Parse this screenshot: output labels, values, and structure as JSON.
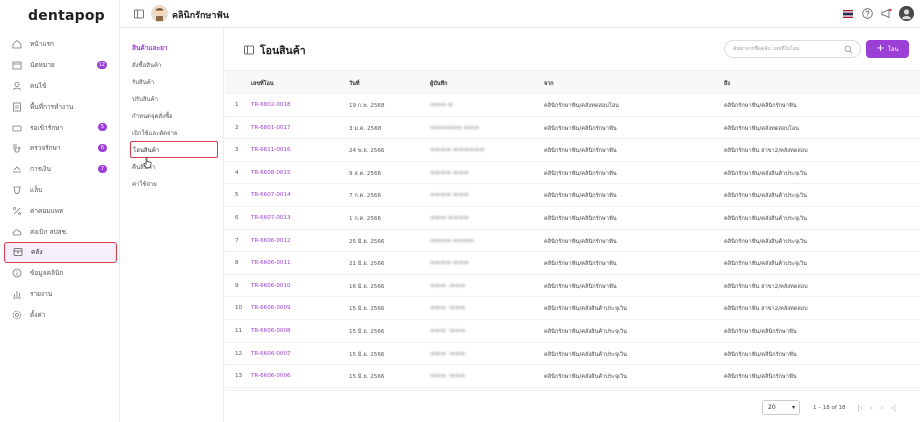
{
  "app": {
    "logo": "dentapop",
    "clinic_name": "คลินิกรักษาฟัน"
  },
  "sidebar": {
    "items": [
      {
        "label": "หน้าแรก",
        "icon": "home-icon",
        "badge": ""
      },
      {
        "label": "นัดหมาย",
        "icon": "calendar-icon",
        "badge": "12"
      },
      {
        "label": "คนไข้",
        "icon": "user-icon",
        "badge": ""
      },
      {
        "label": "พื้นที่การทำงาน",
        "icon": "workspace-icon",
        "badge": ""
      },
      {
        "label": "รอเข้ารักษา",
        "icon": "waiting-icon",
        "badge": "5"
      },
      {
        "label": "ตรวจรักษา",
        "icon": "treatment-icon",
        "badge": "6"
      },
      {
        "label": "การเงิน",
        "icon": "finance-icon",
        "badge": "7"
      },
      {
        "label": "แล็บ",
        "icon": "lab-icon",
        "badge": ""
      },
      {
        "label": "ค่าคอมแพท",
        "icon": "percent-icon",
        "badge": ""
      },
      {
        "label": "ส่งเบิก สปสช.",
        "icon": "cloud-icon",
        "badge": ""
      },
      {
        "label": "คลัง",
        "icon": "inventory-icon",
        "badge": ""
      },
      {
        "label": "ข้อมูลคลินิก",
        "icon": "info-icon",
        "badge": ""
      },
      {
        "label": "รายงาน",
        "icon": "report-icon",
        "badge": ""
      },
      {
        "label": "ตั้งค่า",
        "icon": "gear-icon",
        "badge": ""
      }
    ]
  },
  "subnav": {
    "title": "สินค้าและยา",
    "items": [
      {
        "label": "สั่งซื้อสินค้า"
      },
      {
        "label": "รับสินค้า"
      },
      {
        "label": "ปรับสินค้า"
      },
      {
        "label": "กำหนดจุดสั่งซื้อ"
      },
      {
        "label": "เบิกใช้และตัดจ่าย"
      },
      {
        "label": "โอนสินค้า"
      },
      {
        "label": "คืนสินค้า"
      },
      {
        "label": "ค่าใช้จ่าย"
      }
    ]
  },
  "main": {
    "title": "โอนสินค้า",
    "search_placeholder": "ค้นหาจากชื่อคลัง, เลขที่ใบโอน",
    "add_label": "โอน",
    "columns": {
      "code": "เลขที่โอน",
      "date": "วันที่",
      "user": "ผู้บันทึก",
      "from": "จาก",
      "to": "ถึง"
    },
    "rows": [
      {
        "idx": "1",
        "code": "TR-6802-0018",
        "date": "19 ก.พ. 2568",
        "user": "▬▬▬ ▬",
        "from": "คลินิกรักษาฟัน/คลังทดสอบโอน",
        "to": "คลินิกรักษาฟัน/คลินิกรักษาฟัน"
      },
      {
        "idx": "2",
        "code": "TR-6801-0017",
        "date": "3 ม.ค. 2568",
        "user": "▬▬▬▬▬▬ ▬▬▬",
        "from": "คลินิกรักษาฟัน/คลินิกรักษาฟัน",
        "to": "คลินิกรักษาฟัน/คลังทดสอบโอน"
      },
      {
        "idx": "3",
        "code": "TR-6611-0016",
        "date": "24 พ.ย. 2566",
        "user": "▬▬▬▬ ▬▬▬▬▬▬",
        "from": "คลินิกรักษาฟัน/คลินิกรักษาฟัน",
        "to": "คลินิกรักษาฟัน สาขา2/คลังทดสอบ"
      },
      {
        "idx": "4",
        "code": "TR-6608-0015",
        "date": "9 ส.ค. 2566",
        "user": "▬▬▬▬ ▬▬▬",
        "from": "คลินิกรักษาฟัน/คลินิกรักษาฟัน",
        "to": "คลินิกรักษาฟัน/คลังสินค้าประจุเวิน"
      },
      {
        "idx": "5",
        "code": "TR-6607-0014",
        "date": "7 ก.ค. 2566",
        "user": "▬▬▬▬ ▬▬▬",
        "from": "คลินิกรักษาฟัน/คลินิกรักษาฟัน",
        "to": "คลินิกรักษาฟัน/คลังสินค้าประจุเวิน"
      },
      {
        "idx": "6",
        "code": "TR-6607-0013",
        "date": "1 ก.ค. 2566",
        "user": "▬▬▬ ▬▬▬▬",
        "from": "คลินิกรักษาฟัน/คลินิกรักษาฟัน",
        "to": "คลินิกรักษาฟัน/คลังสินค้าประจุเวิน"
      },
      {
        "idx": "7",
        "code": "TR-6606-0012",
        "date": "25 มิ.ย. 2566",
        "user": "▬▬▬▬ ▬▬▬▬",
        "from": "คลินิกรักษาฟัน/คลินิกรักษาฟัน",
        "to": "คลินิกรักษาฟัน/คลังสินค้าประจุเวิน"
      },
      {
        "idx": "8",
        "code": "TR-6606-0011",
        "date": "21 มิ.ย. 2566",
        "user": "▬▬▬▬ ▬▬▬",
        "from": "คลินิกรักษาฟัน/คลินิกรักษาฟัน",
        "to": "คลินิกรักษาฟัน/คลังสินค้าประจุเวิน"
      },
      {
        "idx": "9",
        "code": "TR-6606-0010",
        "date": "16 มิ.ย. 2566",
        "user": "▬▬▬. ▬▬▬",
        "from": "คลินิกรักษาฟัน/คลินิกรักษาฟัน",
        "to": "คลินิกรักษาฟัน สาขา2/คลังทดสอบ"
      },
      {
        "idx": "10",
        "code": "TR-6606-0009",
        "date": "15 มิ.ย. 2566",
        "user": "▬▬▬. ▬▬▬",
        "from": "คลินิกรักษาฟัน/คลังสินค้าประจุเวิน",
        "to": "คลินิกรักษาฟัน สาขา2/คลังทดสอบ"
      },
      {
        "idx": "11",
        "code": "TR-6606-0008",
        "date": "15 มิ.ย. 2566",
        "user": "▬▬▬. ▬▬▬",
        "from": "คลินิกรักษาฟัน/คลังสินค้าประจุเวิน",
        "to": "คลินิกรักษาฟัน/คลินิกรักษาฟัน"
      },
      {
        "idx": "12",
        "code": "TR-6606-0007",
        "date": "15 มิ.ย. 2566",
        "user": "▬▬▬. ▬▬▬",
        "from": "คลินิกรักษาฟัน/คลังสินค้าประจุเวิน",
        "to": "คลินิกรักษาฟัน/คลินิกรักษาฟัน"
      },
      {
        "idx": "13",
        "code": "TR-6606-0006",
        "date": "15 มิ.ย. 2566",
        "user": "▬▬▬. ▬▬▬",
        "from": "คลินิกรักษาฟัน/คลังสินค้าประจุเวิน",
        "to": "คลินิกรักษาฟัน/คลินิกรักษาฟัน"
      }
    ]
  },
  "footer": {
    "page_size": "20",
    "page_info": "1 – 18 of 18"
  },
  "colors": {
    "accent": "#9b3fd6",
    "highlight": "#d93a4a"
  }
}
